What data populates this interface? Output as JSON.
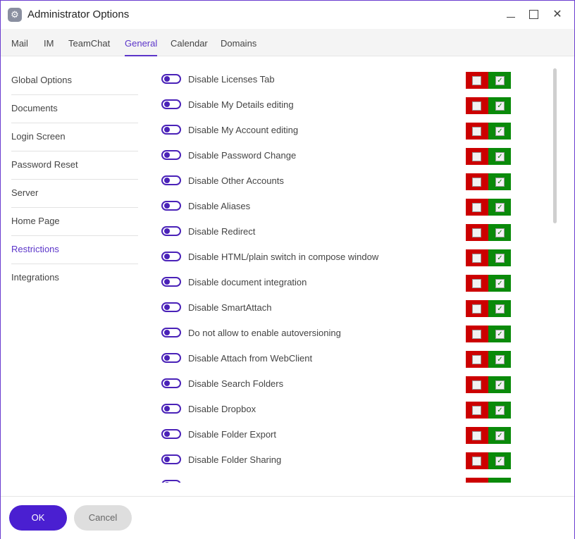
{
  "window": {
    "title": "Administrator Options",
    "icon": "gear-icon"
  },
  "tabs": [
    {
      "label": "Mail"
    },
    {
      "label": "IM"
    },
    {
      "label": "TeamChat"
    },
    {
      "label": "General",
      "active": true
    },
    {
      "label": "Calendar"
    },
    {
      "label": "Domains"
    }
  ],
  "sidebar": {
    "items": [
      {
        "label": "Global Options"
      },
      {
        "label": "Documents"
      },
      {
        "label": "Login Screen"
      },
      {
        "label": "Password Reset"
      },
      {
        "label": "Server"
      },
      {
        "label": "Home Page"
      },
      {
        "label": "Restrictions",
        "active": true
      },
      {
        "label": "Integrations"
      }
    ]
  },
  "options": {
    "rows": [
      {
        "label": "Disable Licenses Tab"
      },
      {
        "label": "Disable My Details editing"
      },
      {
        "label": "Disable My Account editing"
      },
      {
        "label": "Disable Password Change"
      },
      {
        "label": "Disable Other Accounts"
      },
      {
        "label": "Disable Aliases"
      },
      {
        "label": "Disable Redirect"
      },
      {
        "label": "Disable HTML/plain switch in compose window"
      },
      {
        "label": "Disable document integration"
      },
      {
        "label": "Disable SmartAttach"
      },
      {
        "label": "Do not allow to enable autoversioning"
      },
      {
        "label": "Disable Attach from WebClient"
      },
      {
        "label": "Disable Search Folders"
      },
      {
        "label": "Disable Dropbox"
      },
      {
        "label": "Disable Folder Export"
      },
      {
        "label": "Disable Folder Sharing"
      }
    ]
  },
  "footer": {
    "ok_label": "OK",
    "cancel_label": "Cancel"
  },
  "colors": {
    "accent": "#4a1fd1",
    "deny": "#cc0000",
    "allow": "#0a8a0a"
  }
}
